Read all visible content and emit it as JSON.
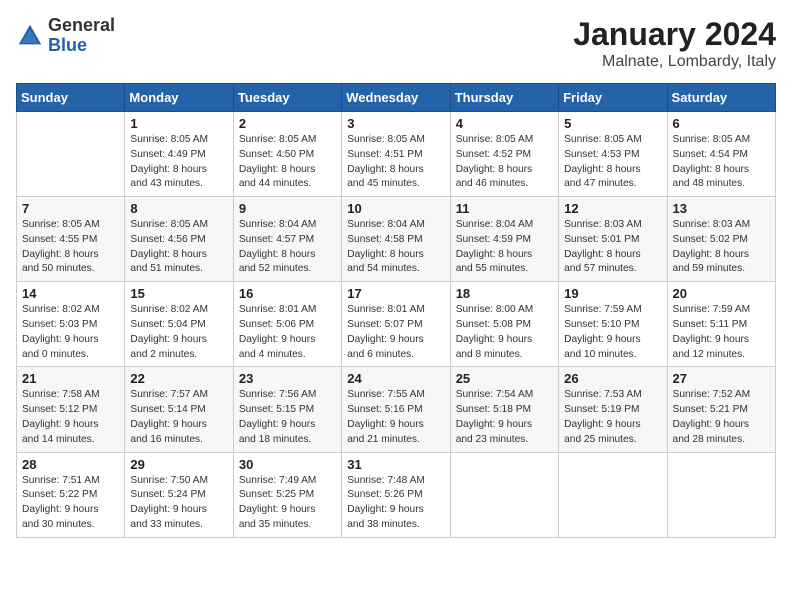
{
  "header": {
    "logo_general": "General",
    "logo_blue": "Blue",
    "month_title": "January 2024",
    "location": "Malnate, Lombardy, Italy"
  },
  "weekdays": [
    "Sunday",
    "Monday",
    "Tuesday",
    "Wednesday",
    "Thursday",
    "Friday",
    "Saturday"
  ],
  "weeks": [
    [
      {
        "day": "",
        "details": ""
      },
      {
        "day": "1",
        "details": "Sunrise: 8:05 AM\nSunset: 4:49 PM\nDaylight: 8 hours\nand 43 minutes."
      },
      {
        "day": "2",
        "details": "Sunrise: 8:05 AM\nSunset: 4:50 PM\nDaylight: 8 hours\nand 44 minutes."
      },
      {
        "day": "3",
        "details": "Sunrise: 8:05 AM\nSunset: 4:51 PM\nDaylight: 8 hours\nand 45 minutes."
      },
      {
        "day": "4",
        "details": "Sunrise: 8:05 AM\nSunset: 4:52 PM\nDaylight: 8 hours\nand 46 minutes."
      },
      {
        "day": "5",
        "details": "Sunrise: 8:05 AM\nSunset: 4:53 PM\nDaylight: 8 hours\nand 47 minutes."
      },
      {
        "day": "6",
        "details": "Sunrise: 8:05 AM\nSunset: 4:54 PM\nDaylight: 8 hours\nand 48 minutes."
      }
    ],
    [
      {
        "day": "7",
        "details": "Sunrise: 8:05 AM\nSunset: 4:55 PM\nDaylight: 8 hours\nand 50 minutes."
      },
      {
        "day": "8",
        "details": "Sunrise: 8:05 AM\nSunset: 4:56 PM\nDaylight: 8 hours\nand 51 minutes."
      },
      {
        "day": "9",
        "details": "Sunrise: 8:04 AM\nSunset: 4:57 PM\nDaylight: 8 hours\nand 52 minutes."
      },
      {
        "day": "10",
        "details": "Sunrise: 8:04 AM\nSunset: 4:58 PM\nDaylight: 8 hours\nand 54 minutes."
      },
      {
        "day": "11",
        "details": "Sunrise: 8:04 AM\nSunset: 4:59 PM\nDaylight: 8 hours\nand 55 minutes."
      },
      {
        "day": "12",
        "details": "Sunrise: 8:03 AM\nSunset: 5:01 PM\nDaylight: 8 hours\nand 57 minutes."
      },
      {
        "day": "13",
        "details": "Sunrise: 8:03 AM\nSunset: 5:02 PM\nDaylight: 8 hours\nand 59 minutes."
      }
    ],
    [
      {
        "day": "14",
        "details": "Sunrise: 8:02 AM\nSunset: 5:03 PM\nDaylight: 9 hours\nand 0 minutes."
      },
      {
        "day": "15",
        "details": "Sunrise: 8:02 AM\nSunset: 5:04 PM\nDaylight: 9 hours\nand 2 minutes."
      },
      {
        "day": "16",
        "details": "Sunrise: 8:01 AM\nSunset: 5:06 PM\nDaylight: 9 hours\nand 4 minutes."
      },
      {
        "day": "17",
        "details": "Sunrise: 8:01 AM\nSunset: 5:07 PM\nDaylight: 9 hours\nand 6 minutes."
      },
      {
        "day": "18",
        "details": "Sunrise: 8:00 AM\nSunset: 5:08 PM\nDaylight: 9 hours\nand 8 minutes."
      },
      {
        "day": "19",
        "details": "Sunrise: 7:59 AM\nSunset: 5:10 PM\nDaylight: 9 hours\nand 10 minutes."
      },
      {
        "day": "20",
        "details": "Sunrise: 7:59 AM\nSunset: 5:11 PM\nDaylight: 9 hours\nand 12 minutes."
      }
    ],
    [
      {
        "day": "21",
        "details": "Sunrise: 7:58 AM\nSunset: 5:12 PM\nDaylight: 9 hours\nand 14 minutes."
      },
      {
        "day": "22",
        "details": "Sunrise: 7:57 AM\nSunset: 5:14 PM\nDaylight: 9 hours\nand 16 minutes."
      },
      {
        "day": "23",
        "details": "Sunrise: 7:56 AM\nSunset: 5:15 PM\nDaylight: 9 hours\nand 18 minutes."
      },
      {
        "day": "24",
        "details": "Sunrise: 7:55 AM\nSunset: 5:16 PM\nDaylight: 9 hours\nand 21 minutes."
      },
      {
        "day": "25",
        "details": "Sunrise: 7:54 AM\nSunset: 5:18 PM\nDaylight: 9 hours\nand 23 minutes."
      },
      {
        "day": "26",
        "details": "Sunrise: 7:53 AM\nSunset: 5:19 PM\nDaylight: 9 hours\nand 25 minutes."
      },
      {
        "day": "27",
        "details": "Sunrise: 7:52 AM\nSunset: 5:21 PM\nDaylight: 9 hours\nand 28 minutes."
      }
    ],
    [
      {
        "day": "28",
        "details": "Sunrise: 7:51 AM\nSunset: 5:22 PM\nDaylight: 9 hours\nand 30 minutes."
      },
      {
        "day": "29",
        "details": "Sunrise: 7:50 AM\nSunset: 5:24 PM\nDaylight: 9 hours\nand 33 minutes."
      },
      {
        "day": "30",
        "details": "Sunrise: 7:49 AM\nSunset: 5:25 PM\nDaylight: 9 hours\nand 35 minutes."
      },
      {
        "day": "31",
        "details": "Sunrise: 7:48 AM\nSunset: 5:26 PM\nDaylight: 9 hours\nand 38 minutes."
      },
      {
        "day": "",
        "details": ""
      },
      {
        "day": "",
        "details": ""
      },
      {
        "day": "",
        "details": ""
      }
    ]
  ]
}
